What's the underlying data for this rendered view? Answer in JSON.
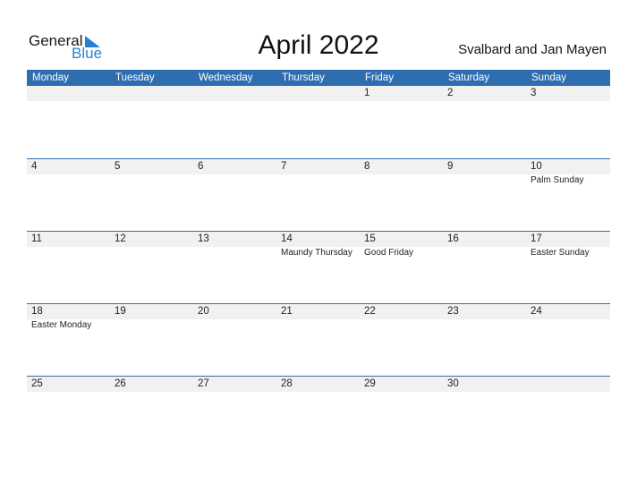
{
  "logo": {
    "word1": "General",
    "word2": "Blue"
  },
  "title": "April 2022",
  "country": "Svalbard and Jan Mayen",
  "weekdays": [
    "Monday",
    "Tuesday",
    "Wednesday",
    "Thursday",
    "Friday",
    "Saturday",
    "Sunday"
  ],
  "weeks": [
    {
      "days": [
        "",
        "",
        "",
        "",
        "1",
        "2",
        "3"
      ],
      "holidays": [
        "",
        "",
        "",
        "",
        "",
        "",
        ""
      ]
    },
    {
      "days": [
        "4",
        "5",
        "6",
        "7",
        "8",
        "9",
        "10"
      ],
      "holidays": [
        "",
        "",
        "",
        "",
        "",
        "",
        "Palm Sunday"
      ]
    },
    {
      "days": [
        "11",
        "12",
        "13",
        "14",
        "15",
        "16",
        "17"
      ],
      "holidays": [
        "",
        "",
        "",
        "Maundy Thursday",
        "Good Friday",
        "",
        "Easter Sunday"
      ]
    },
    {
      "days": [
        "18",
        "19",
        "20",
        "21",
        "22",
        "23",
        "24"
      ],
      "holidays": [
        "Easter Monday",
        "",
        "",
        "",
        "",
        "",
        ""
      ]
    },
    {
      "days": [
        "25",
        "26",
        "27",
        "28",
        "29",
        "30",
        ""
      ],
      "holidays": [
        "",
        "",
        "",
        "",
        "",
        "",
        ""
      ]
    }
  ],
  "colors": {
    "header": "#2e6eb0",
    "strip": "#f1f1f1",
    "logo_blue": "#2a7fd4"
  }
}
